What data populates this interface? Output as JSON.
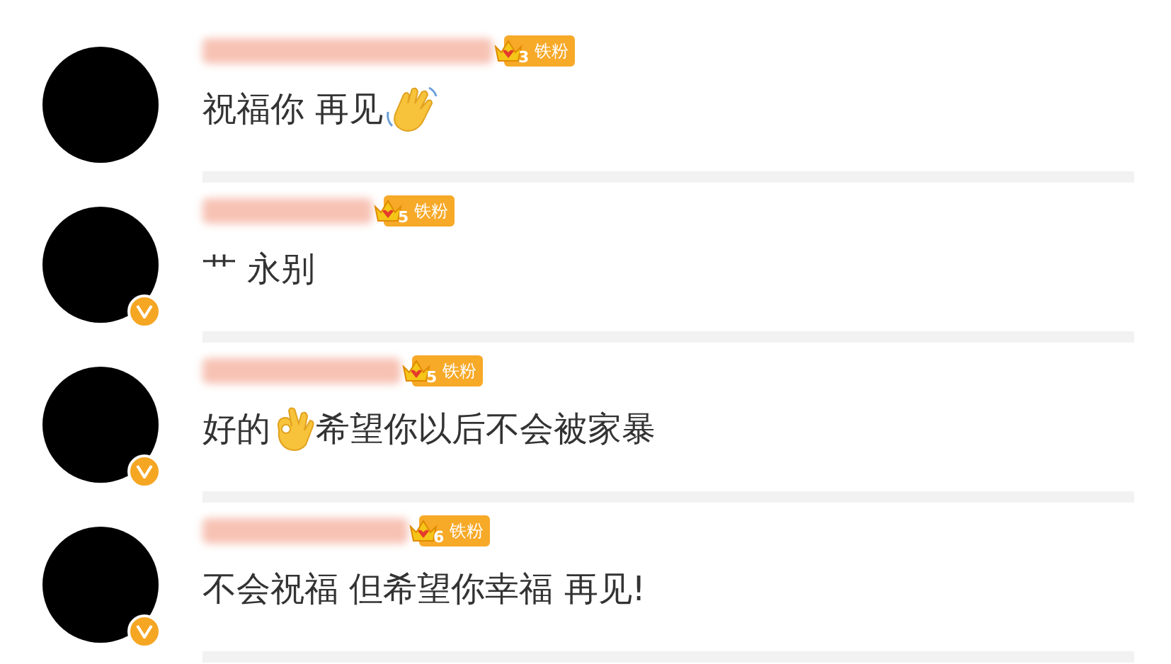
{
  "comments": [
    {
      "verified": false,
      "badge": {
        "rank": "3",
        "label": "铁粉"
      },
      "parts": [
        {
          "kind": "text",
          "text": "祝福你 再见"
        },
        {
          "kind": "wave"
        }
      ]
    },
    {
      "verified": true,
      "badge": {
        "rank": "5",
        "label": "铁粉"
      },
      "parts": [
        {
          "kind": "text",
          "text": "艹 永别"
        }
      ]
    },
    {
      "verified": true,
      "badge": {
        "rank": "5",
        "label": "铁粉"
      },
      "parts": [
        {
          "kind": "text",
          "text": "好的"
        },
        {
          "kind": "ok"
        },
        {
          "kind": "text",
          "text": "希望你以后不会被家暴"
        }
      ]
    },
    {
      "verified": true,
      "badge": {
        "rank": "6",
        "label": "铁粉"
      },
      "parts": [
        {
          "kind": "text",
          "text": "不会祝福 但希望你幸福 再见!"
        }
      ]
    }
  ]
}
